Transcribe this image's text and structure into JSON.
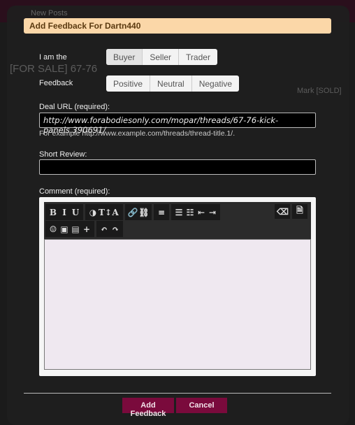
{
  "background": {
    "new_posts": "New Posts",
    "thread_title": "[FOR SALE]  67-76",
    "marked": "Mark [SOLD]"
  },
  "dialog": {
    "title": "Add Feedback For Dartn440",
    "role_label": "I am the",
    "roles": [
      {
        "label": "Buyer",
        "selected": true
      },
      {
        "label": "Seller",
        "selected": false
      },
      {
        "label": "Trader",
        "selected": false
      }
    ],
    "feedback_label": "Feedback",
    "feedback": [
      {
        "label": "Positive"
      },
      {
        "label": "Neutral"
      },
      {
        "label": "Negative"
      }
    ],
    "deal_url_label": "Deal URL (required):",
    "deal_url_value": "http://www.forabodiesonly.com/mopar/threads/67-76-kick-panels.390691/",
    "deal_url_hint": "For example http://www.example.com/threads/thread-title.1/.",
    "short_review_label": "Short Review:",
    "short_review_value": "",
    "comment_label": "Comment (required):",
    "toolbar": {
      "row1": [
        [
          "B",
          "I",
          "U"
        ],
        [
          "◑",
          "T↕",
          "A"
        ],
        [
          "🔗",
          "⛓"
        ],
        [
          "≡"
        ],
        [
          "☰",
          "☷",
          "⇤",
          "⇥"
        ]
      ],
      "row1_right": [
        "⌫",
        "🗎"
      ],
      "row2": [
        [
          "☺",
          "▣",
          "▤",
          "+"
        ],
        [
          "↶",
          "↷"
        ]
      ]
    },
    "submit_label": "Add Feedback",
    "cancel_label": "Cancel",
    "colors": {
      "title_bg": "#fbd7a8",
      "button_bg": "#7a0a3c"
    }
  }
}
